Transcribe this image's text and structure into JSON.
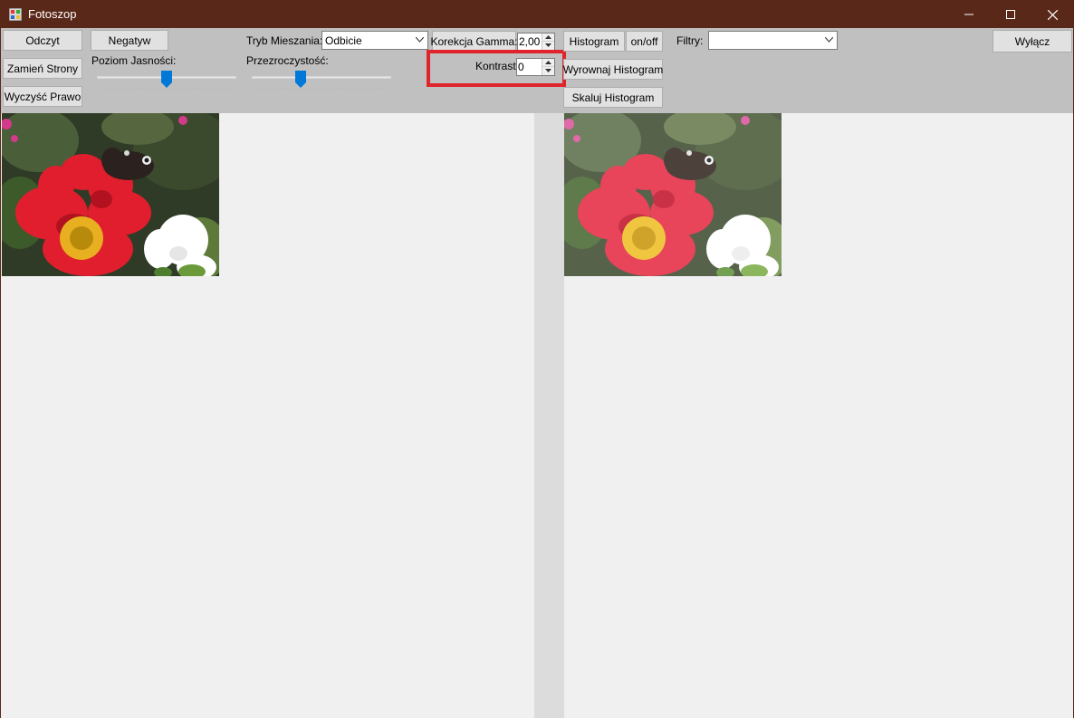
{
  "window": {
    "title": "Fotoszop",
    "controls": [
      "minimize-icon",
      "maximize-icon",
      "close-icon"
    ]
  },
  "toolbar": {
    "read_button": "Odczyt",
    "swap_button": "Zamień Strony",
    "clear_right_button": "Wyczyść Prawo",
    "negative_button": "Negatyw",
    "brightness_label": "Poziom Jasności:",
    "brightness_level": 0.5,
    "blend_mode_label": "Tryb Mieszania:",
    "blend_mode_value": "Odbicie",
    "transparency_label": "Przezroczystość:",
    "transparency_level": 0.35,
    "gamma_button": "Korekcja Gamma:",
    "gamma_value": "2,00",
    "contrast_label": "Kontrast:",
    "contrast_value": "0",
    "histogram_button": "Histogram",
    "histogram_toggle_button": "on/off",
    "equalize_histogram_button": "Wyrownaj Histogram",
    "scale_histogram_button": "Skaluj Histogram",
    "filters_label": "Filtry:",
    "filters_value": "",
    "exit_button": "Wyłącz"
  },
  "colors": {
    "titlebar": "#5a2818",
    "toolbar": "#c0c0c0",
    "highlight": "#e0242c",
    "slider_thumb": "#0078d7"
  }
}
